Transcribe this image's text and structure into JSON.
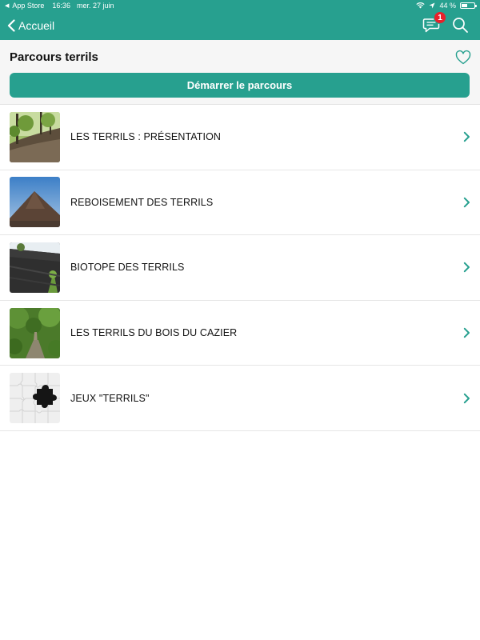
{
  "status_bar": {
    "back_app": "App Store",
    "time": "16:36",
    "date": "mer. 27 juin",
    "battery": "44 %",
    "battery_level": 0.44
  },
  "nav": {
    "back_label": "Accueil",
    "chat_badge": "1"
  },
  "header": {
    "title": "Parcours terrils",
    "start_button": "Démarrer le parcours"
  },
  "list": {
    "items": [
      {
        "label": "LES TERRILS : PRÉSENTATION",
        "thumb": "forest-slope-photo"
      },
      {
        "label": "REBOISEMENT DES TERRILS",
        "thumb": "slag-heap-cone-photo"
      },
      {
        "label": "BIOTOPE DES TERRILS",
        "thumb": "dark-slope-photo"
      },
      {
        "label": "LES TERRILS DU BOIS DU CAZIER",
        "thumb": "green-path-photo"
      },
      {
        "label": "JEUX \"TERRILS\"",
        "thumb": "puzzle-pieces-image"
      }
    ]
  },
  "colors": {
    "accent": "#27a08f",
    "badge": "#e8202a",
    "chevron": "#27a08f"
  }
}
